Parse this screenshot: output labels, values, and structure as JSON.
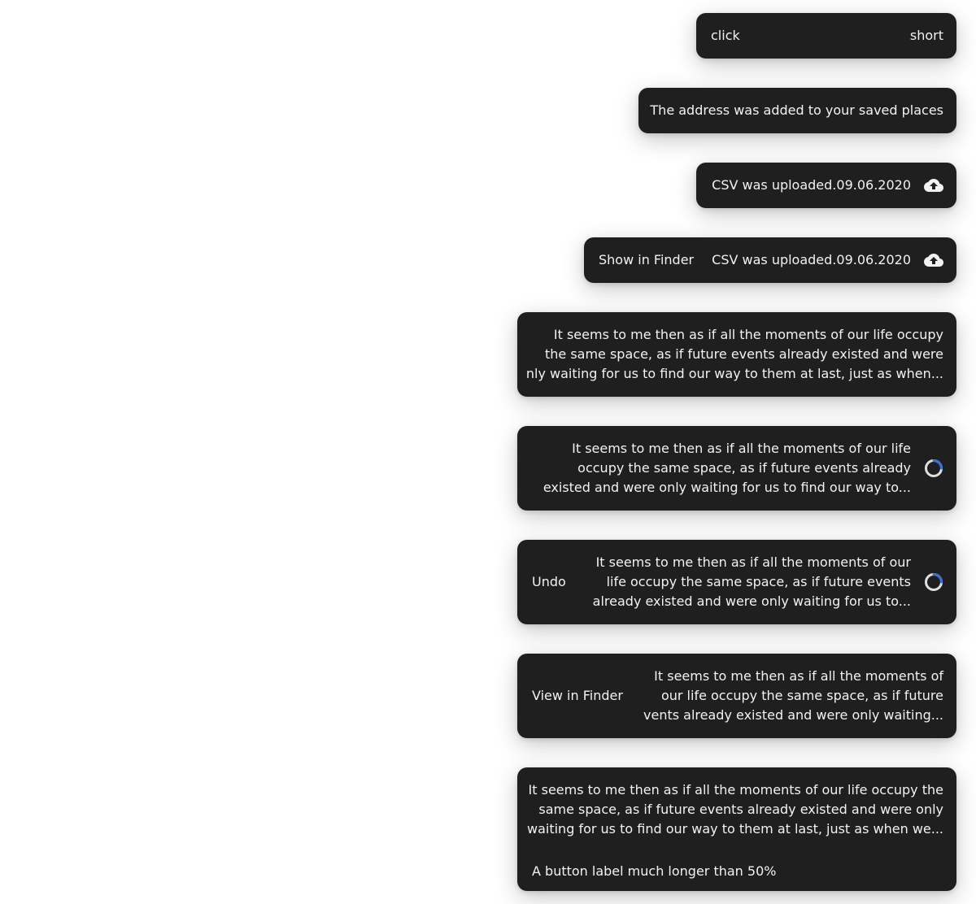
{
  "toasts": [
    {
      "action": "click",
      "text": "short"
    },
    {
      "text": "The address was added to your saved places"
    },
    {
      "text": "CSV was uploaded.09.06.2020",
      "icon": "cloud-upload-icon"
    },
    {
      "text": "CSV was uploaded.09.06.2020",
      "icon": "cloud-upload-icon",
      "action": "Show in Finder"
    },
    {
      "lines": [
        "It seems to me then as if all the moments of our life occupy",
        "the same space, as if future events already existed and were",
        "nly waiting for us to find our way to them at last, just as when..."
      ]
    },
    {
      "icon": "loading-spinner-icon",
      "lines": [
        "It seems to me then as if all the moments of our life",
        "occupy the same space, as if future events already",
        "existed and were only waiting for us to find our way to..."
      ]
    },
    {
      "icon": "loading-spinner-icon",
      "action": "Undo",
      "lines": [
        "It seems to me then as if all the moments of our",
        "life occupy the same space, as if future events",
        "already existed and were only waiting for us to..."
      ]
    },
    {
      "action": "View in Finder",
      "lines": [
        "It seems to me then as if all the moments of",
        "our life occupy the same space, as if future",
        "vents already existed and were only waiting..."
      ]
    },
    {
      "action": "A button label much longer than 50%",
      "lines": [
        "It seems to me then as if all the moments of our life occupy the",
        "same space, as if future events already existed and were only",
        "waiting for us to find our way to them at last, just as when we..."
      ]
    }
  ],
  "colors": {
    "toast_bg": "#1f1f1f",
    "toast_text": "#f2f2f2",
    "spinner_track": "#e0e0e0",
    "spinner_active": "#3b6fd8"
  }
}
